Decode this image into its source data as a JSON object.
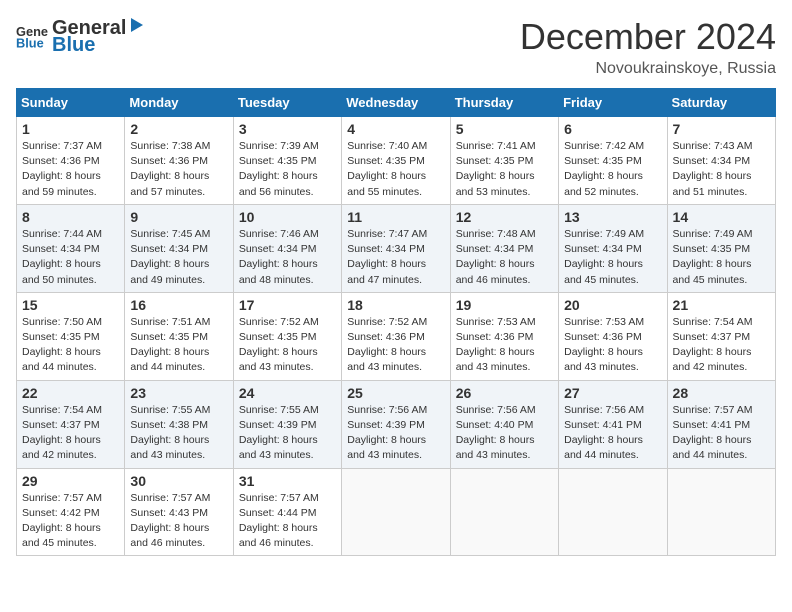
{
  "header": {
    "logo": {
      "text1": "General",
      "text2": "Blue"
    },
    "title": "December 2024",
    "location": "Novoukrainskoye, Russia"
  },
  "days_of_week": [
    "Sunday",
    "Monday",
    "Tuesday",
    "Wednesday",
    "Thursday",
    "Friday",
    "Saturday"
  ],
  "weeks": [
    [
      {
        "day": "1",
        "sunrise": "Sunrise: 7:37 AM",
        "sunset": "Sunset: 4:36 PM",
        "daylight": "Daylight: 8 hours and 59 minutes."
      },
      {
        "day": "2",
        "sunrise": "Sunrise: 7:38 AM",
        "sunset": "Sunset: 4:36 PM",
        "daylight": "Daylight: 8 hours and 57 minutes."
      },
      {
        "day": "3",
        "sunrise": "Sunrise: 7:39 AM",
        "sunset": "Sunset: 4:35 PM",
        "daylight": "Daylight: 8 hours and 56 minutes."
      },
      {
        "day": "4",
        "sunrise": "Sunrise: 7:40 AM",
        "sunset": "Sunset: 4:35 PM",
        "daylight": "Daylight: 8 hours and 55 minutes."
      },
      {
        "day": "5",
        "sunrise": "Sunrise: 7:41 AM",
        "sunset": "Sunset: 4:35 PM",
        "daylight": "Daylight: 8 hours and 53 minutes."
      },
      {
        "day": "6",
        "sunrise": "Sunrise: 7:42 AM",
        "sunset": "Sunset: 4:35 PM",
        "daylight": "Daylight: 8 hours and 52 minutes."
      },
      {
        "day": "7",
        "sunrise": "Sunrise: 7:43 AM",
        "sunset": "Sunset: 4:34 PM",
        "daylight": "Daylight: 8 hours and 51 minutes."
      }
    ],
    [
      {
        "day": "8",
        "sunrise": "Sunrise: 7:44 AM",
        "sunset": "Sunset: 4:34 PM",
        "daylight": "Daylight: 8 hours and 50 minutes."
      },
      {
        "day": "9",
        "sunrise": "Sunrise: 7:45 AM",
        "sunset": "Sunset: 4:34 PM",
        "daylight": "Daylight: 8 hours and 49 minutes."
      },
      {
        "day": "10",
        "sunrise": "Sunrise: 7:46 AM",
        "sunset": "Sunset: 4:34 PM",
        "daylight": "Daylight: 8 hours and 48 minutes."
      },
      {
        "day": "11",
        "sunrise": "Sunrise: 7:47 AM",
        "sunset": "Sunset: 4:34 PM",
        "daylight": "Daylight: 8 hours and 47 minutes."
      },
      {
        "day": "12",
        "sunrise": "Sunrise: 7:48 AM",
        "sunset": "Sunset: 4:34 PM",
        "daylight": "Daylight: 8 hours and 46 minutes."
      },
      {
        "day": "13",
        "sunrise": "Sunrise: 7:49 AM",
        "sunset": "Sunset: 4:34 PM",
        "daylight": "Daylight: 8 hours and 45 minutes."
      },
      {
        "day": "14",
        "sunrise": "Sunrise: 7:49 AM",
        "sunset": "Sunset: 4:35 PM",
        "daylight": "Daylight: 8 hours and 45 minutes."
      }
    ],
    [
      {
        "day": "15",
        "sunrise": "Sunrise: 7:50 AM",
        "sunset": "Sunset: 4:35 PM",
        "daylight": "Daylight: 8 hours and 44 minutes."
      },
      {
        "day": "16",
        "sunrise": "Sunrise: 7:51 AM",
        "sunset": "Sunset: 4:35 PM",
        "daylight": "Daylight: 8 hours and 44 minutes."
      },
      {
        "day": "17",
        "sunrise": "Sunrise: 7:52 AM",
        "sunset": "Sunset: 4:35 PM",
        "daylight": "Daylight: 8 hours and 43 minutes."
      },
      {
        "day": "18",
        "sunrise": "Sunrise: 7:52 AM",
        "sunset": "Sunset: 4:36 PM",
        "daylight": "Daylight: 8 hours and 43 minutes."
      },
      {
        "day": "19",
        "sunrise": "Sunrise: 7:53 AM",
        "sunset": "Sunset: 4:36 PM",
        "daylight": "Daylight: 8 hours and 43 minutes."
      },
      {
        "day": "20",
        "sunrise": "Sunrise: 7:53 AM",
        "sunset": "Sunset: 4:36 PM",
        "daylight": "Daylight: 8 hours and 43 minutes."
      },
      {
        "day": "21",
        "sunrise": "Sunrise: 7:54 AM",
        "sunset": "Sunset: 4:37 PM",
        "daylight": "Daylight: 8 hours and 42 minutes."
      }
    ],
    [
      {
        "day": "22",
        "sunrise": "Sunrise: 7:54 AM",
        "sunset": "Sunset: 4:37 PM",
        "daylight": "Daylight: 8 hours and 42 minutes."
      },
      {
        "day": "23",
        "sunrise": "Sunrise: 7:55 AM",
        "sunset": "Sunset: 4:38 PM",
        "daylight": "Daylight: 8 hours and 43 minutes."
      },
      {
        "day": "24",
        "sunrise": "Sunrise: 7:55 AM",
        "sunset": "Sunset: 4:39 PM",
        "daylight": "Daylight: 8 hours and 43 minutes."
      },
      {
        "day": "25",
        "sunrise": "Sunrise: 7:56 AM",
        "sunset": "Sunset: 4:39 PM",
        "daylight": "Daylight: 8 hours and 43 minutes."
      },
      {
        "day": "26",
        "sunrise": "Sunrise: 7:56 AM",
        "sunset": "Sunset: 4:40 PM",
        "daylight": "Daylight: 8 hours and 43 minutes."
      },
      {
        "day": "27",
        "sunrise": "Sunrise: 7:56 AM",
        "sunset": "Sunset: 4:41 PM",
        "daylight": "Daylight: 8 hours and 44 minutes."
      },
      {
        "day": "28",
        "sunrise": "Sunrise: 7:57 AM",
        "sunset": "Sunset: 4:41 PM",
        "daylight": "Daylight: 8 hours and 44 minutes."
      }
    ],
    [
      {
        "day": "29",
        "sunrise": "Sunrise: 7:57 AM",
        "sunset": "Sunset: 4:42 PM",
        "daylight": "Daylight: 8 hours and 45 minutes."
      },
      {
        "day": "30",
        "sunrise": "Sunrise: 7:57 AM",
        "sunset": "Sunset: 4:43 PM",
        "daylight": "Daylight: 8 hours and 46 minutes."
      },
      {
        "day": "31",
        "sunrise": "Sunrise: 7:57 AM",
        "sunset": "Sunset: 4:44 PM",
        "daylight": "Daylight: 8 hours and 46 minutes."
      },
      null,
      null,
      null,
      null
    ]
  ]
}
